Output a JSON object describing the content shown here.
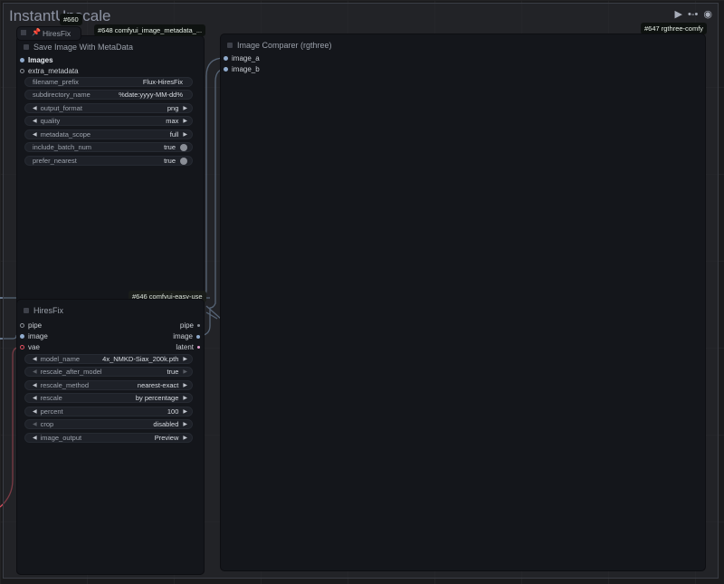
{
  "group": {
    "title": "InstantUpscale"
  },
  "badges": {
    "hiresfix_id": "#660",
    "metadata_id": "#648 comfyui_image_metadata_...",
    "comparer_id": "#647 rgthree-comfy",
    "wire_label": "#646 comfyui-easy-use"
  },
  "collapsed_node": {
    "title": "HiresFix"
  },
  "save_node": {
    "title": "Save Image With MetaData",
    "inputs": [
      "Images",
      "extra_metadata"
    ],
    "widgets": [
      {
        "label": "filename_prefix",
        "value": "Flux-HiresFix"
      },
      {
        "label": "subdirectory_name",
        "value": "%date:yyyy-MM-dd%"
      },
      {
        "label": "output_format",
        "value": "png"
      },
      {
        "label": "quality",
        "value": "max"
      },
      {
        "label": "metadata_scope",
        "value": "full"
      },
      {
        "label": "include_batch_num",
        "value": "true"
      },
      {
        "label": "prefer_nearest",
        "value": "true"
      }
    ]
  },
  "comparer_node": {
    "title": "Image Comparer (rgthree)",
    "inputs": [
      "image_a",
      "image_b"
    ]
  },
  "hires_node": {
    "title": "HiresFix",
    "inputs": [
      "pipe",
      "image",
      "vae"
    ],
    "outputs": [
      "pipe",
      "image",
      "latent"
    ],
    "widgets": [
      {
        "label": "model_name",
        "value": "4x_NMKD-Siax_200k.pth"
      },
      {
        "label": "rescale_after_model",
        "value": "true"
      },
      {
        "label": "rescale_method",
        "value": "nearest-exact"
      },
      {
        "label": "rescale",
        "value": "by percentage"
      },
      {
        "label": "percent",
        "value": "100"
      },
      {
        "label": "crop",
        "value": "disabled"
      },
      {
        "label": "image_output",
        "value": "Preview"
      }
    ]
  },
  "colors": {
    "image_wire": "#8faacc",
    "vae_wire": "#e05060"
  }
}
